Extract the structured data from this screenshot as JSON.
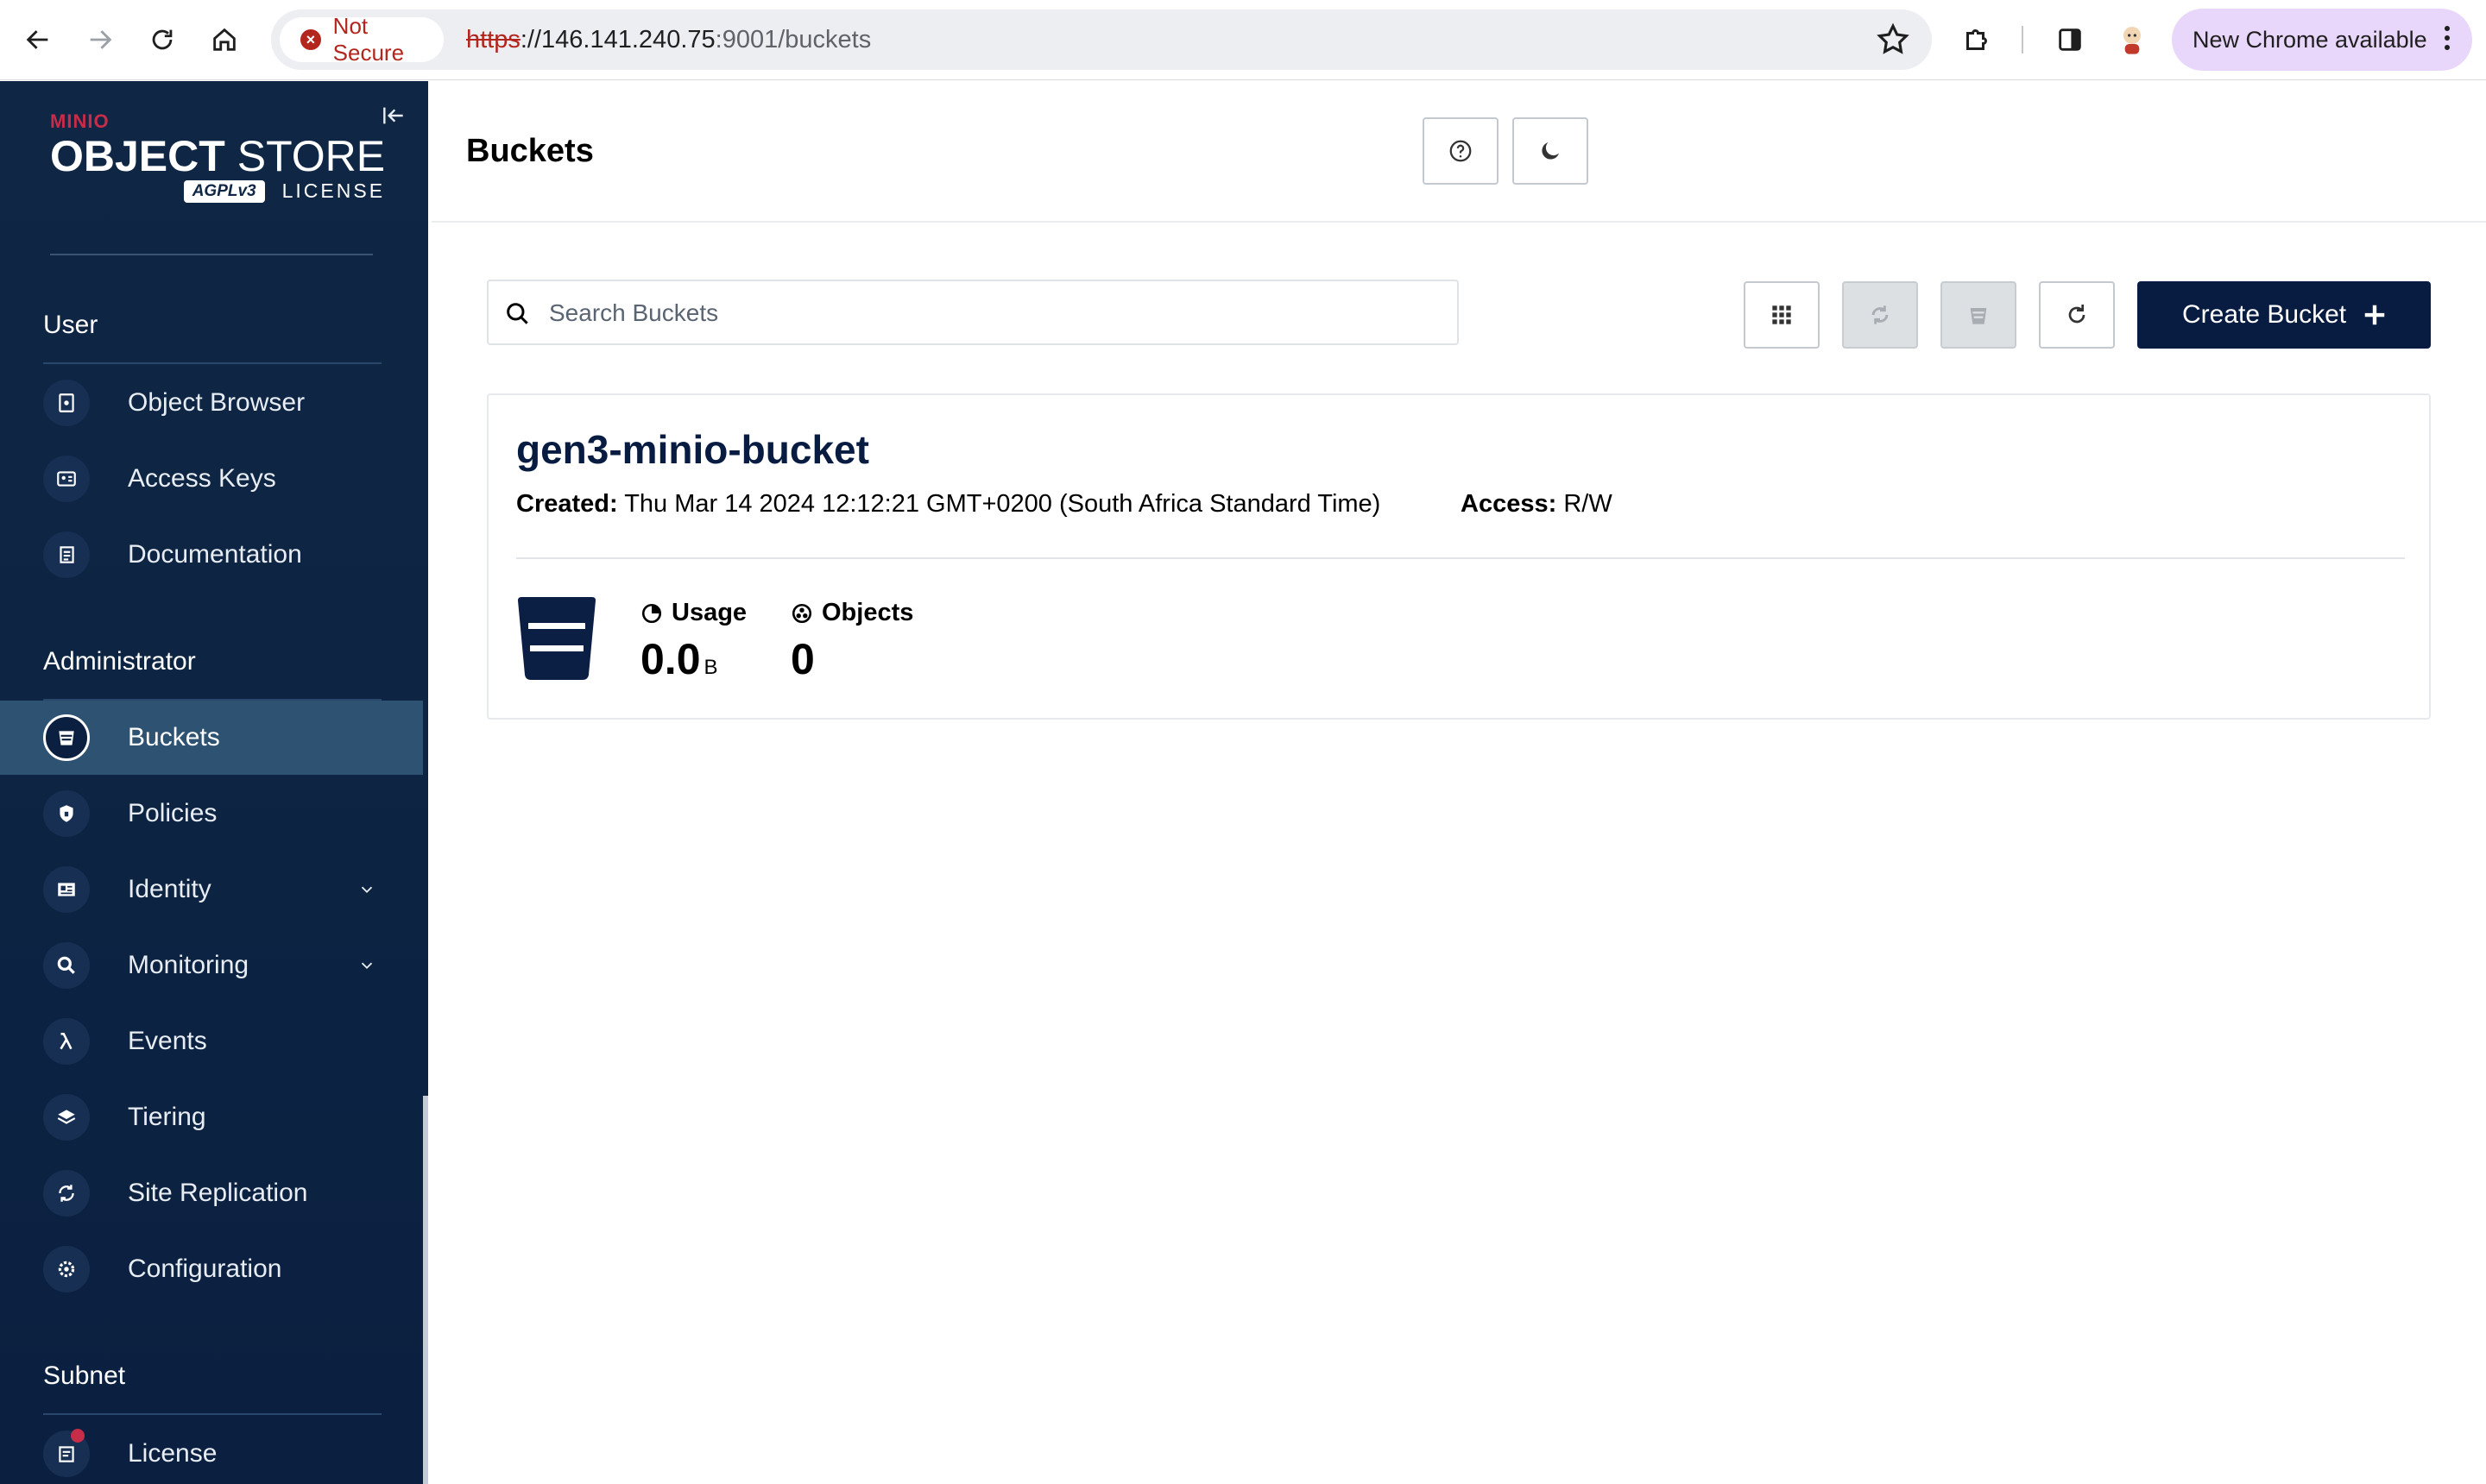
{
  "browser": {
    "security_label": "Not Secure",
    "url_scheme": "https",
    "url_rest": "://146.141.240.75",
    "url_port_path": ":9001/buckets",
    "update_label": "New Chrome available"
  },
  "sidebar": {
    "brand_small": "MINIO",
    "brand_object": "OBJECT",
    "brand_store": "STORE",
    "brand_agpl": "AGPLv3",
    "brand_license": "LICENSE",
    "sections": {
      "user": "User",
      "administrator": "Administrator",
      "subnet": "Subnet"
    },
    "items": {
      "object_browser": "Object Browser",
      "access_keys": "Access Keys",
      "documentation": "Documentation",
      "buckets": "Buckets",
      "policies": "Policies",
      "identity": "Identity",
      "monitoring": "Monitoring",
      "events": "Events",
      "tiering": "Tiering",
      "site_replication": "Site Replication",
      "configuration": "Configuration",
      "license": "License"
    },
    "active_item": "buckets"
  },
  "header": {
    "title": "Buckets"
  },
  "toolbar": {
    "search_placeholder": "Search Buckets",
    "create_label": "Create Bucket"
  },
  "buckets": [
    {
      "name": "gen3-minio-bucket",
      "created_label": "Created:",
      "created_value": "Thu Mar 14 2024 12:12:21 GMT+0200 (South Africa Standard Time)",
      "access_label": "Access:",
      "access_value": "R/W",
      "usage_label": "Usage",
      "usage_value": "0.0",
      "usage_unit": "B",
      "objects_label": "Objects",
      "objects_value": "0"
    }
  ],
  "colors": {
    "sidebar_bg": "#0f2745",
    "accent_navy": "#081c42",
    "brand_red": "#c72c48",
    "active_item_bg": "#2e5272"
  }
}
